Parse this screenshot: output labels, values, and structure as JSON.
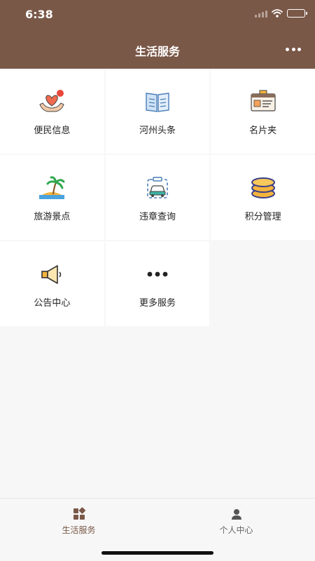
{
  "status_bar": {
    "time": "6:38"
  },
  "nav": {
    "title": "生活服务"
  },
  "services": [
    {
      "label": "便民信息",
      "icon": "heart-hands-icon"
    },
    {
      "label": "河州头条",
      "icon": "open-book-icon"
    },
    {
      "label": "名片夹",
      "icon": "id-card-icon"
    },
    {
      "label": "旅游景点",
      "icon": "palm-island-icon"
    },
    {
      "label": "违章查询",
      "icon": "car-icon"
    },
    {
      "label": "积分管理",
      "icon": "coin-stack-icon"
    },
    {
      "label": "公告中心",
      "icon": "megaphone-icon"
    },
    {
      "label": "更多服务",
      "icon": "more-dots-icon"
    }
  ],
  "tabbar": {
    "tabs": [
      {
        "label": "生活服务",
        "icon": "grid-icon",
        "active": true
      },
      {
        "label": "个人中心",
        "icon": "person-icon",
        "active": false
      }
    ]
  },
  "colors": {
    "brand": "#7a5848",
    "active_tab": "#7a5848",
    "inactive_tab": "#666666"
  }
}
